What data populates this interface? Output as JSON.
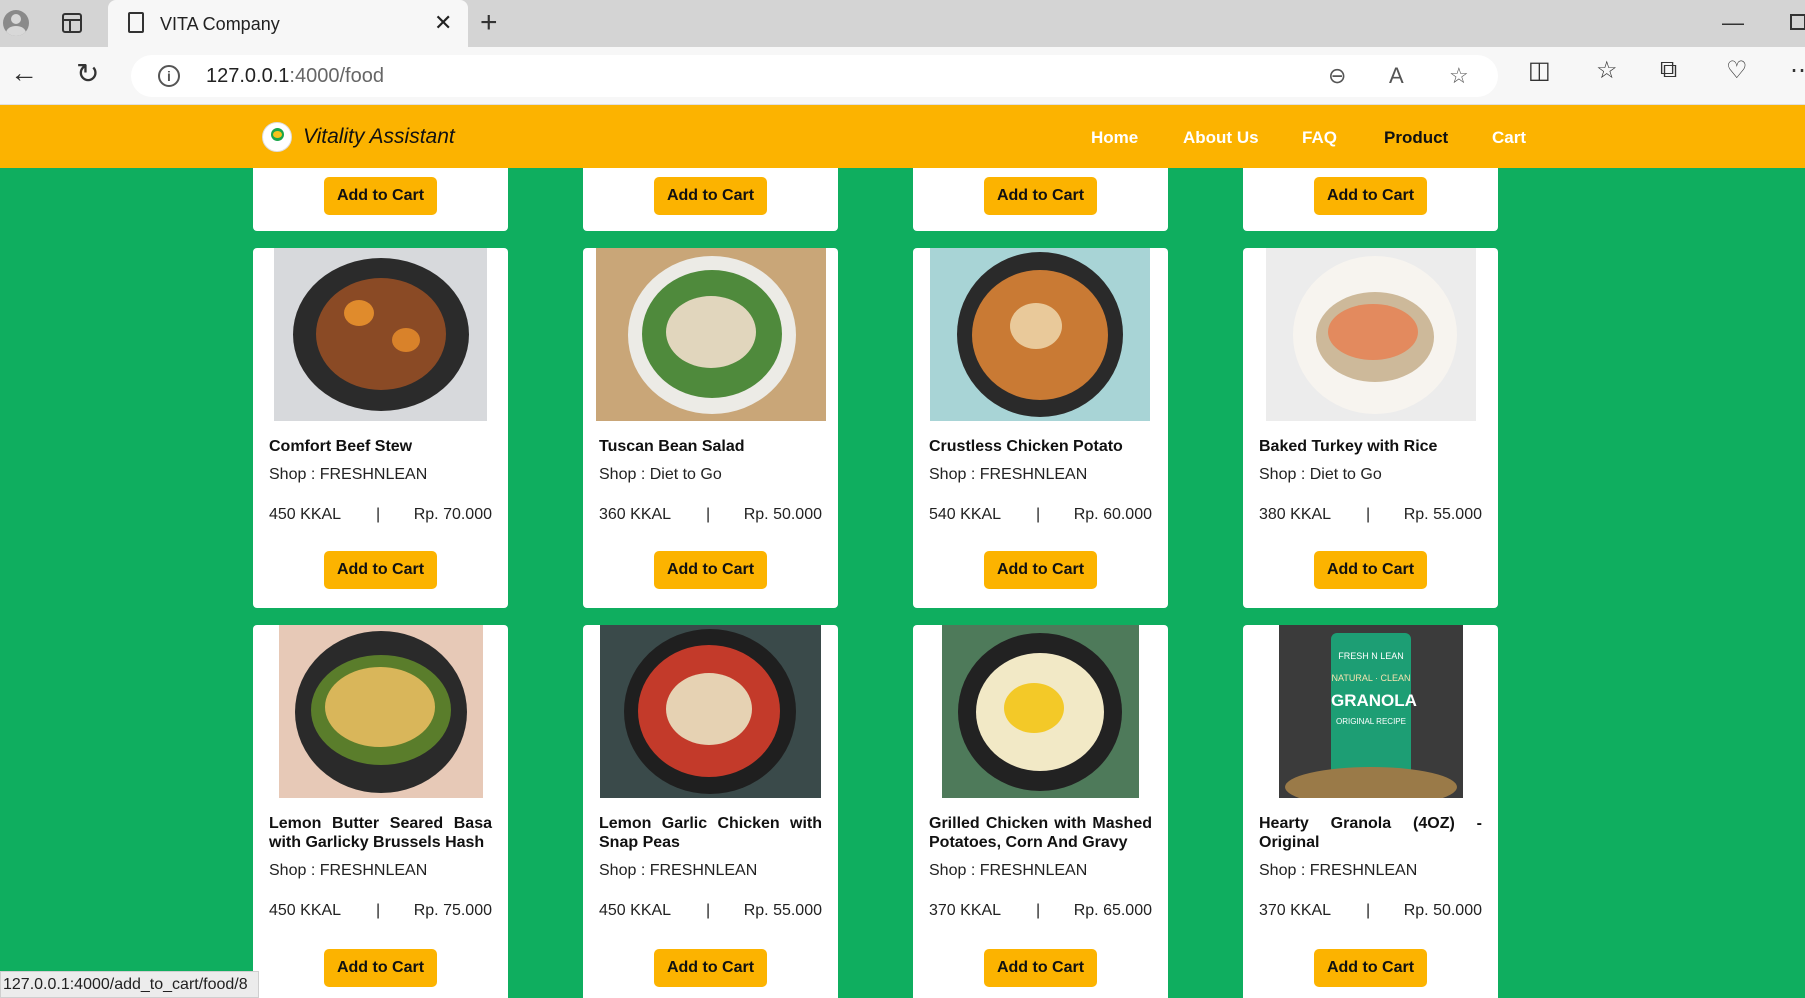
{
  "browser": {
    "tab_title": "VITA Company",
    "url_host": "127.0.0.1",
    "url_path": ":4000/food",
    "status_url": "127.0.0.1:4000/add_to_cart/food/8"
  },
  "site": {
    "brand": "Vitality Assistant",
    "nav": [
      "Home",
      "About Us",
      "FAQ",
      "Product",
      "Cart"
    ],
    "active_nav": "Product"
  },
  "colors": {
    "header": "#fcb300",
    "background": "#0fae5f",
    "button": "#fcb300"
  },
  "top_row": {
    "button_label": "Add to Cart"
  },
  "products": [
    {
      "name": "Comfort Beef Stew",
      "shop": "Shop : FRESHNLEAN",
      "kcal": "450 KKAL",
      "sep": "|",
      "price": "Rp. 70.000",
      "button": "Add to Cart"
    },
    {
      "name": "Tuscan Bean Salad",
      "shop": "Shop : Diet to Go",
      "kcal": "360 KKAL",
      "sep": "|",
      "price": "Rp. 50.000",
      "button": "Add to Cart"
    },
    {
      "name": "Crustless Chicken Potato",
      "shop": "Shop : FRESHNLEAN",
      "kcal": "540 KKAL",
      "sep": "|",
      "price": "Rp. 60.000",
      "button": "Add to Cart"
    },
    {
      "name": "Baked Turkey with Rice",
      "shop": "Shop : Diet to Go",
      "kcal": "380 KKAL",
      "sep": "|",
      "price": "Rp. 55.000",
      "button": "Add to Cart"
    },
    {
      "name": "Lemon Butter Seared Basa with Garlicky Brussels Hash",
      "shop": "Shop : FRESHNLEAN",
      "kcal": "450 KKAL",
      "sep": "|",
      "price": "Rp. 75.000",
      "button": "Add to Cart"
    },
    {
      "name": "Lemon Garlic Chicken with Snap Peas",
      "shop": "Shop : FRESHNLEAN",
      "kcal": "450 KKAL",
      "sep": "|",
      "price": "Rp. 55.000",
      "button": "Add to Cart"
    },
    {
      "name": "Grilled Chicken with Mashed Potatoes, Corn And Gravy",
      "shop": "Shop : FRESHNLEAN",
      "kcal": "370 KKAL",
      "sep": "|",
      "price": "Rp. 65.000",
      "button": "Add to Cart"
    },
    {
      "name": "Hearty Granola (4OZ) - Original",
      "shop": "Shop : FRESHNLEAN",
      "kcal": "370 KKAL",
      "sep": "|",
      "price": "Rp. 50.000",
      "button": "Add to Cart"
    }
  ],
  "packaging": {
    "brand": "FRESH N LEAN",
    "line1": "NATURAL · CLEAN",
    "product": "GRANOLA",
    "line2": "ORIGINAL RECIPE"
  }
}
